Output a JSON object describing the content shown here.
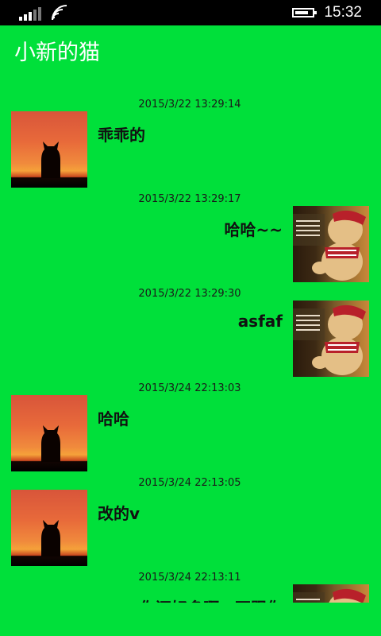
{
  "status": {
    "time": "15:32"
  },
  "header": {
    "title": "小新的猫"
  },
  "messages": [
    {
      "timestamp": "2015/3/22 13:29:14",
      "text": "乖乖的",
      "side": "left"
    },
    {
      "timestamp": "2015/3/22 13:29:17",
      "text": "哈哈~~",
      "side": "right"
    },
    {
      "timestamp": "2015/3/22 13:29:30",
      "text": "asfaf",
      "side": "right"
    },
    {
      "timestamp": "2015/3/24 22:13:03",
      "text": "哈哈",
      "side": "left"
    },
    {
      "timestamp": "2015/3/24 22:13:05",
      "text": "改的v",
      "side": "left"
    },
    {
      "timestamp": "2015/3/24 22:13:11",
      "text": "你还好多啊，不跟你",
      "side": "right"
    }
  ]
}
